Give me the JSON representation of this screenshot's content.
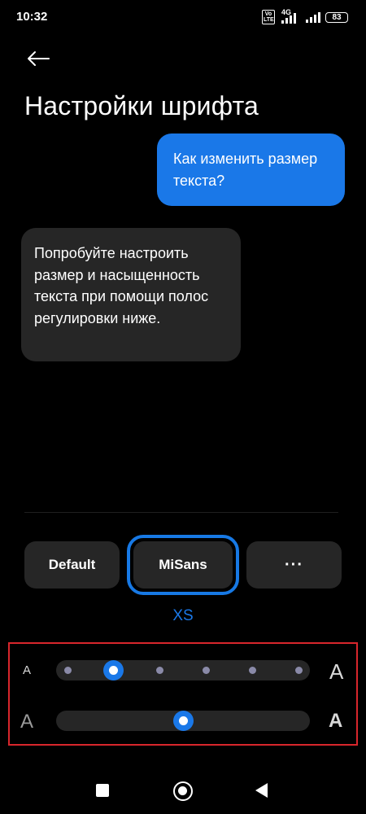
{
  "status_bar": {
    "time": "10:32",
    "volte_label": "Vo LTE",
    "network": "4G",
    "battery": "83"
  },
  "header": {
    "title": "Настройки шрифта"
  },
  "chat": {
    "question": "Как изменить размер текста?",
    "answer": "Попробуйте настроить размер и насыщенность текста при помощи полос регулировки ниже."
  },
  "font_options": {
    "items": [
      {
        "label": "Default"
      },
      {
        "label": "MiSans"
      },
      {
        "label": "···"
      }
    ],
    "selected": "MiSans"
  },
  "size_label": "XS",
  "sliders": {
    "size": {
      "min_label": "A",
      "max_label": "A",
      "steps": 6,
      "selected_index": 1
    },
    "weight": {
      "min_label": "A",
      "max_label": "A",
      "value": 0.5
    }
  },
  "colors": {
    "accent": "#1a78e8",
    "highlight_box": "#d8262c",
    "bubble_dark": "#262626"
  }
}
